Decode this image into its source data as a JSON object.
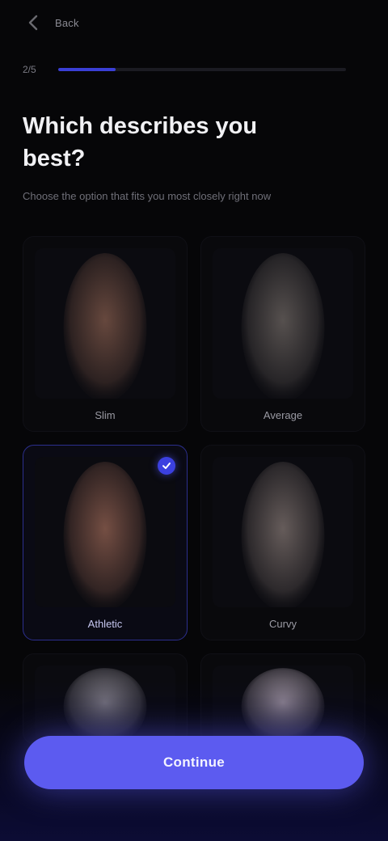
{
  "header": {
    "back_icon": "chevron-left-icon",
    "label": "Back"
  },
  "progress": {
    "step_text": "2/5",
    "fraction": 0.2
  },
  "question": {
    "title": "Which describes you best?",
    "subtitle": "Choose the option that fits you most closely right now"
  },
  "options": [
    {
      "label": "Slim",
      "selected": false,
      "tone": "#6b4b40"
    },
    {
      "label": "Average",
      "selected": false,
      "tone": "#5a5452"
    },
    {
      "label": "Athletic",
      "selected": true,
      "tone": "#7a5246"
    },
    {
      "label": "Curvy",
      "selected": false,
      "tone": "#6a605e"
    },
    {
      "label": "",
      "selected": false,
      "tone": "#8a8690"
    },
    {
      "label": "",
      "selected": false,
      "tone": "#a69aa8"
    }
  ],
  "cta": {
    "label": "Continue"
  },
  "colors": {
    "accent": "#5c5bf0",
    "background": "#060608"
  }
}
